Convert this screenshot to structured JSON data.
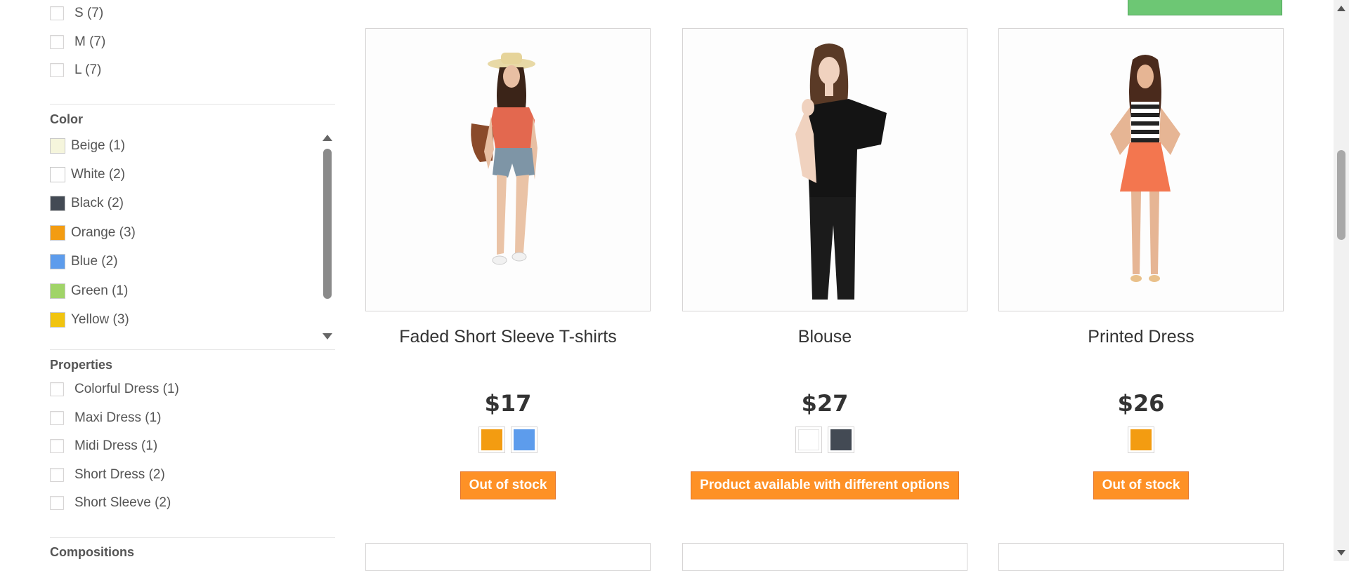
{
  "size_filter": {
    "items": [
      {
        "label": "S (7)"
      },
      {
        "label": "M (7)"
      },
      {
        "label": "L (7)"
      }
    ]
  },
  "color_filter": {
    "title": "Color",
    "items": [
      {
        "label": "Beige (1)",
        "color": "#f5f5dc"
      },
      {
        "label": "White (2)",
        "color": "#ffffff"
      },
      {
        "label": "Black (2)",
        "color": "#434a54"
      },
      {
        "label": "Orange (3)",
        "color": "#f39c11"
      },
      {
        "label": "Blue (2)",
        "color": "#5d9cec"
      },
      {
        "label": "Green (1)",
        "color": "#a0d468"
      },
      {
        "label": "Yellow (3)",
        "color": "#f1c40f"
      }
    ]
  },
  "properties_filter": {
    "title": "Properties",
    "items": [
      {
        "label": "Colorful Dress (1)"
      },
      {
        "label": "Maxi Dress (1)"
      },
      {
        "label": "Midi Dress (1)"
      },
      {
        "label": "Short Dress (2)"
      },
      {
        "label": "Short Sleeve (2)"
      }
    ]
  },
  "compositions_filter": {
    "title": "Compositions"
  },
  "products": [
    {
      "name": "Faded Short Sleeve T-shirts",
      "price": "$17",
      "colors": [
        "#f39c11",
        "#5d9cec"
      ],
      "availability": "Out of stock"
    },
    {
      "name": "Blouse",
      "price": "$27",
      "colors": [
        "#ffffff",
        "#434a54"
      ],
      "availability": "Product available with different options"
    },
    {
      "name": "Printed Dress",
      "price": "$26",
      "colors": [
        "#f39c11"
      ],
      "availability": "Out of stock"
    }
  ],
  "theme": {
    "badge_orange": "#fe9126",
    "green_button": "#6dc774"
  }
}
